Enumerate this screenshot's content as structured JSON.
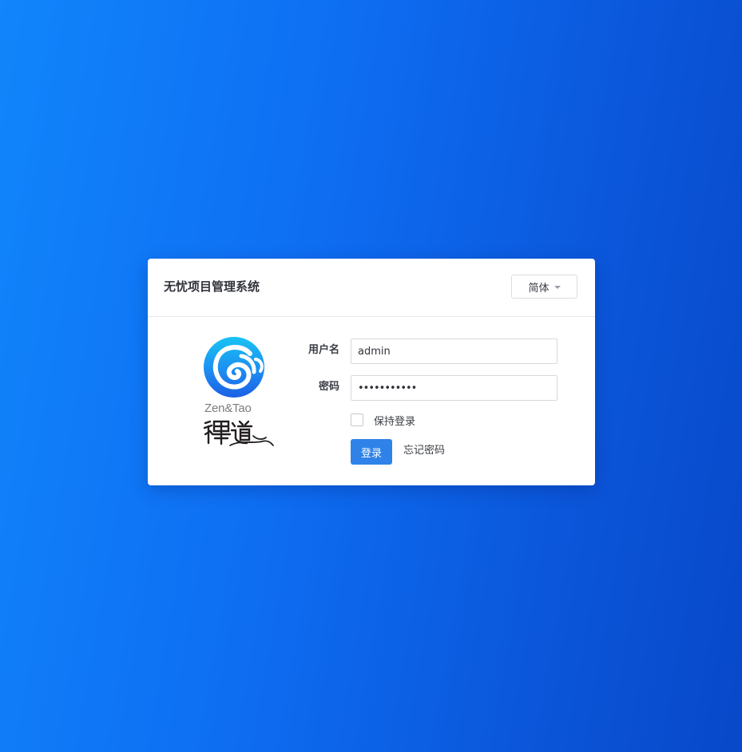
{
  "header": {
    "title": "无忧项目管理系统"
  },
  "language": {
    "selected": "简体"
  },
  "logo": {
    "text": "Zen&Tao",
    "mark": "禪道",
    "icon": "zentao-swirl-icon"
  },
  "form": {
    "username_label": "用户名",
    "username_value": "admin",
    "password_label": "密码",
    "password_value": "•••••••••••",
    "remember_label": "保持登录",
    "remember_checked": false,
    "submit_label": "登录",
    "forgot_label": "忘记密码"
  },
  "colors": {
    "background_start": "#1185fb",
    "background_end": "#0848c9",
    "primary": "#2f83e8",
    "logo_blue": "#1e6ff0",
    "logo_cyan": "#19c3f3"
  }
}
